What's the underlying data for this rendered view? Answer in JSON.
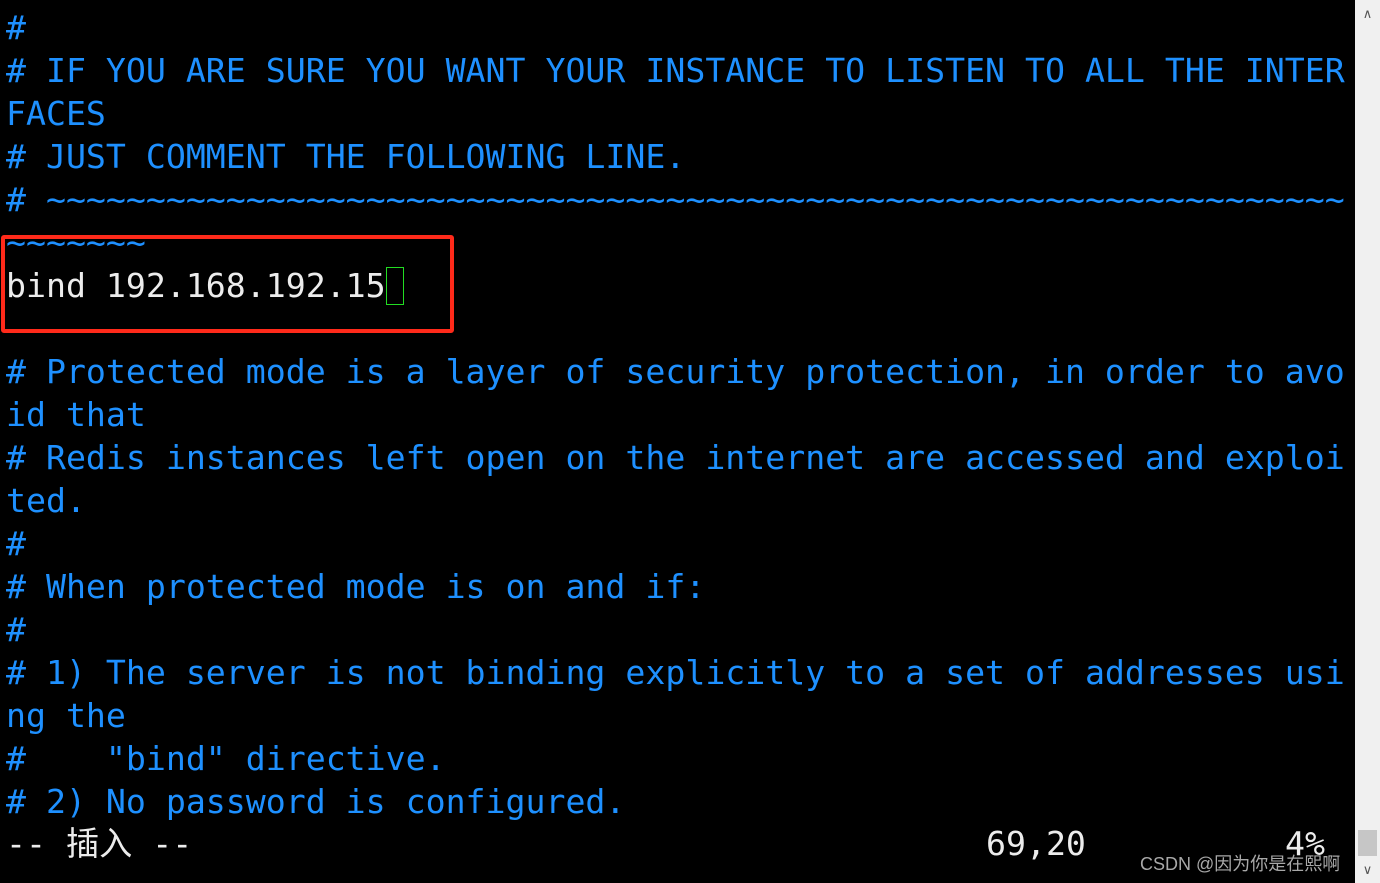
{
  "editor": {
    "lines": [
      "#",
      "# IF YOU ARE SURE YOU WANT YOUR INSTANCE TO LISTEN TO ALL THE INTER",
      "FACES",
      "# JUST COMMENT THE FOLLOWING LINE.",
      "# ~~~~~~~~~~~~~~~~~~~~~~~~~~~~~~~~~~~~~~~~~~~~~~~~~~~~~~~~~~~~~~~~~",
      "~~~~~~~",
      "bind 192.168.192.15",
      "",
      "# Protected mode is a layer of security protection, in order to avo",
      "id that",
      "# Redis instances left open on the internet are accessed and exploi",
      "ted.",
      "#",
      "# When protected mode is on and if:",
      "#",
      "# 1) The server is not binding explicitly to a set of addresses usi",
      "ng the",
      "#    \"bind\" directive.",
      "# 2) No password is configured."
    ]
  },
  "status": {
    "mode": "-- 插入 --",
    "position": "69,20",
    "percent": "4%"
  },
  "watermark": "CSDN @因为你是在熙啊",
  "colors": {
    "comment": "#1e90ff",
    "text": "#ececec",
    "highlight": "#ff2a1a",
    "cursor": "#22dd22"
  },
  "scrollbar": {
    "up_icon": "chevron-up-icon",
    "down_icon": "chevron-down-icon",
    "position_percent": 96
  }
}
